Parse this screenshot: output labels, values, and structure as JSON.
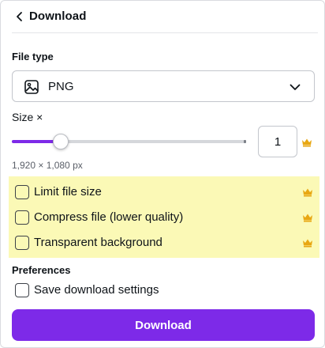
{
  "header": {
    "title": "Download"
  },
  "file_type": {
    "label": "File type",
    "selected": "PNG"
  },
  "size": {
    "label": "Size ×",
    "value": "1",
    "slider_fraction": 0.21,
    "dimensions": "1,920 × 1,080 px"
  },
  "options": [
    {
      "label": "Limit file size",
      "checked": false,
      "pro": true
    },
    {
      "label": "Compress file (lower quality)",
      "checked": false,
      "pro": true
    },
    {
      "label": "Transparent background",
      "checked": false,
      "pro": true
    }
  ],
  "preferences": {
    "label": "Preferences",
    "save_settings_label": "Save download settings",
    "save_settings_checked": false
  },
  "download_button": {
    "label": "Download"
  },
  "colors": {
    "accent": "#7d2ae8",
    "highlight": "#fbf9b6",
    "crown": "#e8a713"
  },
  "icons": [
    "chevron-left-icon",
    "image-icon",
    "chevron-down-icon",
    "crown-icon"
  ]
}
